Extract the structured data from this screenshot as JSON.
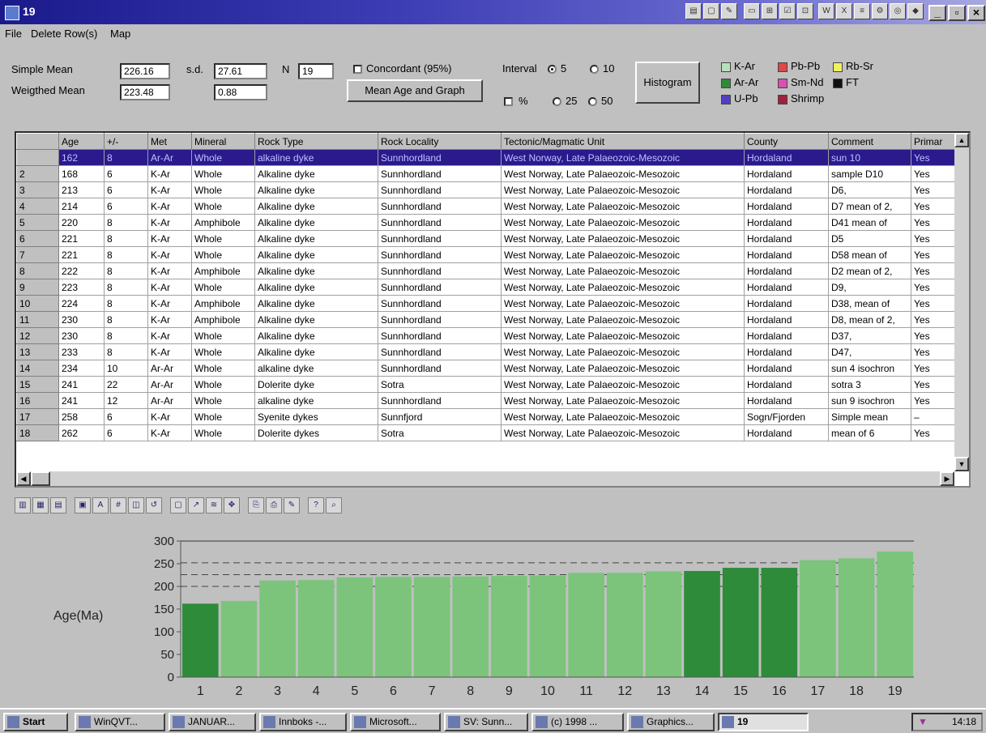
{
  "window": {
    "title": "19"
  },
  "menu": {
    "items": [
      "File",
      "Delete Row(s)",
      "Map"
    ]
  },
  "stats": {
    "simple_mean_label": "Simple Mean",
    "simple_mean_value": "226.16",
    "sd_label": "s.d.",
    "sd_value": "27.61",
    "n_label": "N",
    "n_value": "19",
    "weighted_mean_label": "Weigthed Mean",
    "weighted_mean_value": "223.48",
    "weighted_sd_value": "0.88",
    "concordant_label": "Concordant (95%)",
    "mean_age_button": "Mean Age and Graph",
    "interval_label": "Interval",
    "interval_opts": [
      "5",
      "10",
      "25",
      "50"
    ],
    "interval_selected": "5",
    "percent_label": "%",
    "histogram_button": "Histogram"
  },
  "legend": [
    {
      "label": "K-Ar",
      "color": "#b8e0b8"
    },
    {
      "label": "Pb-Pb",
      "color": "#e04848"
    },
    {
      "label": "Rb-Sr",
      "color": "#f0f060"
    },
    {
      "label": "Ar-Ar",
      "color": "#2e8b3a"
    },
    {
      "label": "Sm-Nd",
      "color": "#d850b0"
    },
    {
      "label": "FT",
      "color": "#101010"
    },
    {
      "label": "U-Pb",
      "color": "#5040c0"
    },
    {
      "label": "Shrimp",
      "color": "#a02040"
    }
  ],
  "table": {
    "headers": [
      "",
      "Age",
      "+/-",
      "Met",
      "Mineral",
      "Rock Type",
      "Rock Locality",
      "Tectonic/Magmatic Unit",
      "County",
      "Comment",
      "Primar"
    ],
    "rows": [
      [
        "",
        "162",
        "8",
        "Ar-Ar",
        "Whole",
        "alkaline dyke",
        "Sunnhordland",
        "West Norway, Late Palaeozoic-Mesozoic",
        "Hordaland",
        "sun 10",
        "Yes"
      ],
      [
        "2",
        "168",
        "6",
        "K-Ar",
        "Whole",
        "Alkaline dyke",
        "Sunnhordland",
        "West Norway, Late Palaeozoic-Mesozoic",
        "Hordaland",
        "sample D10",
        "Yes"
      ],
      [
        "3",
        "213",
        "6",
        "K-Ar",
        "Whole",
        "Alkaline dyke",
        "Sunnhordland",
        "West Norway, Late Palaeozoic-Mesozoic",
        "Hordaland",
        "D6,",
        "Yes"
      ],
      [
        "4",
        "214",
        "6",
        "K-Ar",
        "Whole",
        "Alkaline dyke",
        "Sunnhordland",
        "West Norway, Late Palaeozoic-Mesozoic",
        "Hordaland",
        "D7 mean of 2,",
        "Yes"
      ],
      [
        "5",
        "220",
        "8",
        "K-Ar",
        "Amphibole",
        "Alkaline dyke",
        "Sunnhordland",
        "West Norway, Late Palaeozoic-Mesozoic",
        "Hordaland",
        "D41 mean of",
        "Yes"
      ],
      [
        "6",
        "221",
        "8",
        "K-Ar",
        "Whole",
        "Alkaline dyke",
        "Sunnhordland",
        "West Norway, Late Palaeozoic-Mesozoic",
        "Hordaland",
        "D5",
        "Yes"
      ],
      [
        "7",
        "221",
        "8",
        "K-Ar",
        "Whole",
        "Alkaline dyke",
        "Sunnhordland",
        "West Norway, Late Palaeozoic-Mesozoic",
        "Hordaland",
        "D58 mean of",
        "Yes"
      ],
      [
        "8",
        "222",
        "8",
        "K-Ar",
        "Amphibole",
        "Alkaline dyke",
        "Sunnhordland",
        "West Norway, Late Palaeozoic-Mesozoic",
        "Hordaland",
        "D2 mean of 2,",
        "Yes"
      ],
      [
        "9",
        "223",
        "8",
        "K-Ar",
        "Whole",
        "Alkaline dyke",
        "Sunnhordland",
        "West Norway, Late Palaeozoic-Mesozoic",
        "Hordaland",
        "D9,",
        "Yes"
      ],
      [
        "10",
        "224",
        "8",
        "K-Ar",
        "Amphibole",
        "Alkaline dyke",
        "Sunnhordland",
        "West Norway, Late Palaeozoic-Mesozoic",
        "Hordaland",
        "D38, mean of",
        "Yes"
      ],
      [
        "11",
        "230",
        "8",
        "K-Ar",
        "Amphibole",
        "Alkaline dyke",
        "Sunnhordland",
        "West Norway, Late Palaeozoic-Mesozoic",
        "Hordaland",
        "D8, mean of 2,",
        "Yes"
      ],
      [
        "12",
        "230",
        "8",
        "K-Ar",
        "Whole",
        "Alkaline dyke",
        "Sunnhordland",
        "West Norway, Late Palaeozoic-Mesozoic",
        "Hordaland",
        "D37,",
        "Yes"
      ],
      [
        "13",
        "233",
        "8",
        "K-Ar",
        "Whole",
        "Alkaline dyke",
        "Sunnhordland",
        "West Norway, Late Palaeozoic-Mesozoic",
        "Hordaland",
        "D47,",
        "Yes"
      ],
      [
        "14",
        "234",
        "10",
        "Ar-Ar",
        "Whole",
        "alkaline dyke",
        "Sunnhordland",
        "West Norway, Late Palaeozoic-Mesozoic",
        "Hordaland",
        "sun 4 isochron",
        "Yes"
      ],
      [
        "15",
        "241",
        "22",
        "Ar-Ar",
        "Whole",
        "Dolerite dyke",
        "Sotra",
        "West Norway, Late Palaeozoic-Mesozoic",
        "Hordaland",
        "sotra 3",
        "Yes"
      ],
      [
        "16",
        "241",
        "12",
        "Ar-Ar",
        "Whole",
        "alkaline dyke",
        "Sunnhordland",
        "West Norway, Late Palaeozoic-Mesozoic",
        "Hordaland",
        "sun 9 isochron",
        "Yes"
      ],
      [
        "17",
        "258",
        "6",
        "K-Ar",
        "Whole",
        "Syenite dykes",
        "Sunnfjord",
        "West Norway, Late Palaeozoic-Mesozoic",
        "Sogn/Fjorden",
        "Simple mean",
        "–"
      ],
      [
        "18",
        "262",
        "6",
        "K-Ar",
        "Whole",
        "Dolerite dykes",
        "Sotra",
        "West Norway, Late Palaeozoic-Mesozoic",
        "Hordaland",
        "mean of 6",
        "Yes"
      ]
    ]
  },
  "chart_data": {
    "type": "bar",
    "ylabel": "Age(Ma)",
    "ylim": [
      0,
      300
    ],
    "yticks": [
      0,
      50,
      100,
      150,
      200,
      250,
      300
    ],
    "categories": [
      "1",
      "2",
      "3",
      "4",
      "5",
      "6",
      "7",
      "8",
      "9",
      "10",
      "11",
      "12",
      "13",
      "14",
      "15",
      "16",
      "17",
      "18",
      "19"
    ],
    "values": [
      162,
      168,
      213,
      214,
      220,
      221,
      221,
      222,
      223,
      224,
      230,
      230,
      233,
      234,
      241,
      241,
      258,
      262,
      277
    ],
    "methods": [
      "Ar-Ar",
      "K-Ar",
      "K-Ar",
      "K-Ar",
      "K-Ar",
      "K-Ar",
      "K-Ar",
      "K-Ar",
      "K-Ar",
      "K-Ar",
      "K-Ar",
      "K-Ar",
      "K-Ar",
      "Ar-Ar",
      "Ar-Ar",
      "Ar-Ar",
      "K-Ar",
      "K-Ar",
      "K-Ar"
    ],
    "reference_lines": [
      200,
      226,
      252
    ],
    "colors": {
      "K-Ar": "#7cc47c",
      "Ar-Ar": "#2e8b3a"
    }
  },
  "taskbar": {
    "start": "Start",
    "tasks": [
      "WinQVT...",
      "JANUAR...",
      "Innboks -...",
      "Microsoft...",
      "SV: Sunn...",
      "(c) 1998 ...",
      "Graphics...",
      "19"
    ],
    "clock": "14:18"
  }
}
